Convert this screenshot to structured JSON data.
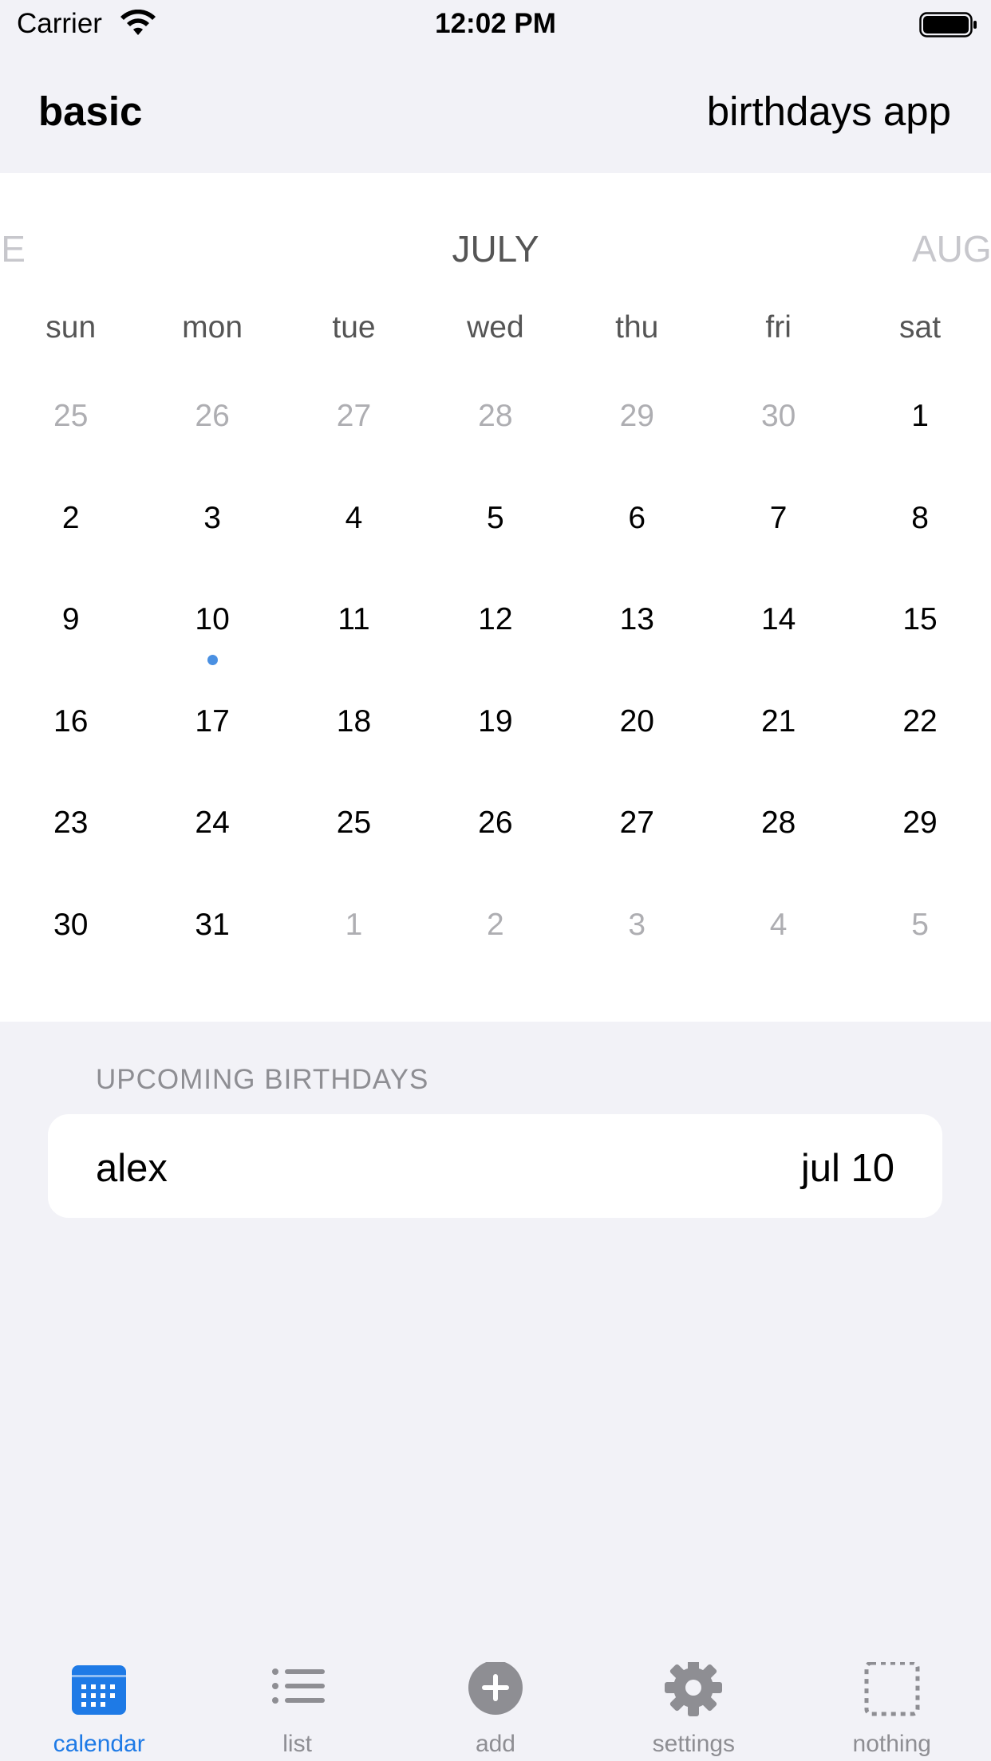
{
  "status_bar": {
    "carrier": "Carrier",
    "time": "12:02 PM"
  },
  "nav": {
    "left_title": "basic",
    "right_title": "birthdays app"
  },
  "calendar": {
    "prev_month": "NE",
    "current_month": "JULY",
    "next_month": "AUG",
    "weekdays": [
      "sun",
      "mon",
      "tue",
      "wed",
      "thu",
      "fri",
      "sat"
    ],
    "days": [
      {
        "label": "25",
        "muted": true
      },
      {
        "label": "26",
        "muted": true
      },
      {
        "label": "27",
        "muted": true
      },
      {
        "label": "28",
        "muted": true
      },
      {
        "label": "29",
        "muted": true
      },
      {
        "label": "30",
        "muted": true
      },
      {
        "label": "1",
        "muted": false
      },
      {
        "label": "2",
        "muted": false
      },
      {
        "label": "3",
        "muted": false
      },
      {
        "label": "4",
        "muted": false
      },
      {
        "label": "5",
        "muted": false
      },
      {
        "label": "6",
        "muted": false
      },
      {
        "label": "7",
        "muted": false
      },
      {
        "label": "8",
        "muted": false
      },
      {
        "label": "9",
        "muted": false
      },
      {
        "label": "10",
        "muted": false,
        "has_event": true
      },
      {
        "label": "11",
        "muted": false
      },
      {
        "label": "12",
        "muted": false
      },
      {
        "label": "13",
        "muted": false
      },
      {
        "label": "14",
        "muted": false
      },
      {
        "label": "15",
        "muted": false
      },
      {
        "label": "16",
        "muted": false
      },
      {
        "label": "17",
        "muted": false
      },
      {
        "label": "18",
        "muted": false
      },
      {
        "label": "19",
        "muted": false
      },
      {
        "label": "20",
        "muted": false
      },
      {
        "label": "21",
        "muted": false
      },
      {
        "label": "22",
        "muted": false
      },
      {
        "label": "23",
        "muted": false
      },
      {
        "label": "24",
        "muted": false
      },
      {
        "label": "25",
        "muted": false
      },
      {
        "label": "26",
        "muted": false
      },
      {
        "label": "27",
        "muted": false
      },
      {
        "label": "28",
        "muted": false
      },
      {
        "label": "29",
        "muted": false
      },
      {
        "label": "30",
        "muted": false
      },
      {
        "label": "31",
        "muted": false
      },
      {
        "label": "1",
        "muted": true
      },
      {
        "label": "2",
        "muted": true
      },
      {
        "label": "3",
        "muted": true
      },
      {
        "label": "4",
        "muted": true
      },
      {
        "label": "5",
        "muted": true
      }
    ],
    "event_dot_color": "#4a90e2"
  },
  "upcoming": {
    "header": "UPCOMING BIRTHDAYS",
    "items": [
      {
        "name": "alex",
        "date": "jul 10"
      }
    ]
  },
  "tabbar": {
    "accent_color": "#1e7ae6",
    "tabs": [
      {
        "label": "calendar",
        "icon": "calendar-icon",
        "active": true
      },
      {
        "label": "list",
        "icon": "list-icon",
        "active": false
      },
      {
        "label": "add",
        "icon": "plus-circle-icon",
        "active": false
      },
      {
        "label": "settings",
        "icon": "gear-icon",
        "active": false
      },
      {
        "label": "nothing",
        "icon": "dashed-square-icon",
        "active": false
      }
    ]
  }
}
